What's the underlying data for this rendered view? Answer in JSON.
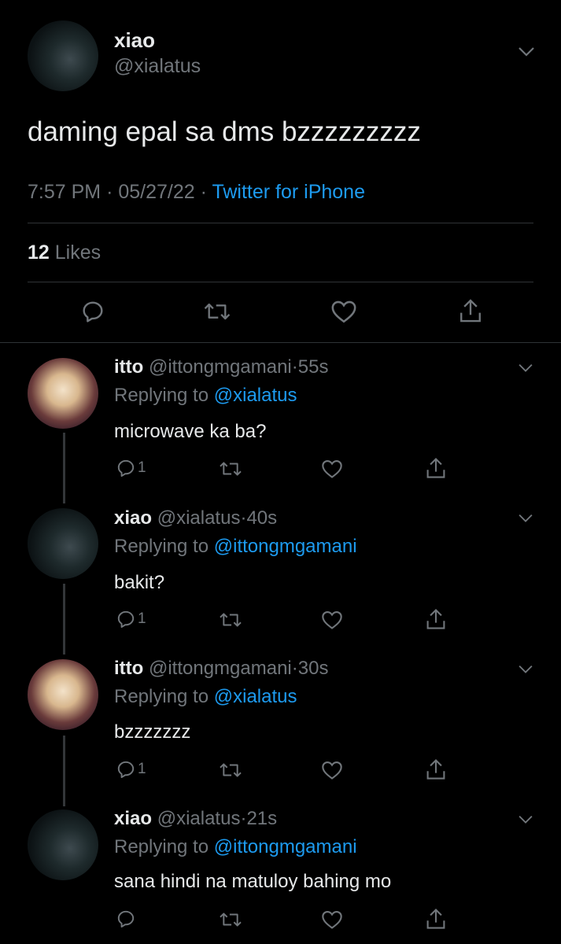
{
  "main_tweet": {
    "name": "xiao",
    "handle": "@xialatus",
    "text": "daming epal sa dms bzzzzzzzzz",
    "time": "7:57 PM",
    "date": "05/27/22",
    "source": "Twitter for iPhone",
    "likes_count": "12",
    "likes_label": "Likes"
  },
  "replies": [
    {
      "name": "itto",
      "handle": "@ittongmgamani",
      "time": "55s",
      "replying_label": "Replying to",
      "replying_to": "@xialatus",
      "text": "microwave ka ba?",
      "reply_count": "1"
    },
    {
      "name": "xiao",
      "handle": "@xialatus",
      "time": "40s",
      "replying_label": "Replying to",
      "replying_to": "@ittongmgamani",
      "text": "bakit?",
      "reply_count": "1"
    },
    {
      "name": "itto",
      "handle": "@ittongmgamani",
      "time": "30s",
      "replying_label": "Replying to",
      "replying_to": "@xialatus",
      "text": "bzzzzzzz",
      "reply_count": "1"
    },
    {
      "name": "xiao",
      "handle": "@xialatus",
      "time": "21s",
      "replying_label": "Replying to",
      "replying_to": "@ittongmgamani",
      "text": "sana hindi na matuloy bahing mo",
      "reply_count": ""
    }
  ],
  "separator_dot": "·",
  "icons": [
    "chevron-down-icon",
    "reply-icon",
    "retweet-icon",
    "like-icon",
    "share-icon"
  ],
  "colors": {
    "background": "#000000",
    "text": "#e7e9ea",
    "muted": "#71767b",
    "link": "#1d9bf0",
    "divider": "#2f3336"
  }
}
